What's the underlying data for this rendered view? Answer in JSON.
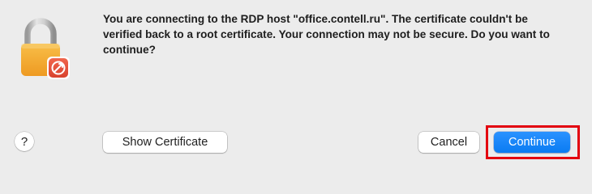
{
  "dialog": {
    "message": "You are connecting to the RDP host \"office.contell.ru\". The certificate couldn't be verified back to a root certificate. Your connection may not be secure. Do you want to continue?",
    "icon": "lock-with-rdp-badge-icon",
    "help_label": "?",
    "buttons": {
      "show_certificate": "Show Certificate",
      "cancel": "Cancel",
      "continue": "Continue"
    }
  },
  "colors": {
    "background": "#ECECEC",
    "accent": "#0A84FF",
    "highlight": "#E3000F",
    "lock_body": "#F4A833",
    "badge": "#E5533D"
  }
}
